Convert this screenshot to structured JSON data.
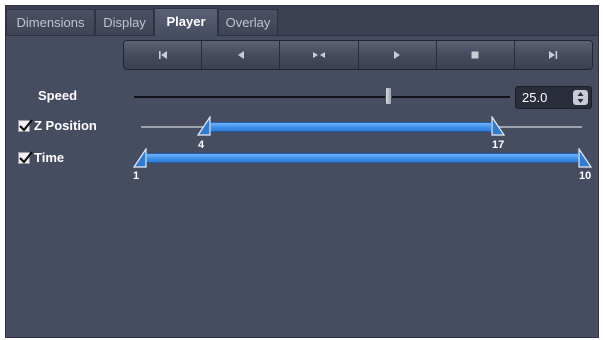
{
  "tabs": [
    {
      "label": "Dimensions",
      "active": false
    },
    {
      "label": "Display",
      "active": false
    },
    {
      "label": "Player",
      "active": true
    },
    {
      "label": "Overlay",
      "active": false
    }
  ],
  "player_controls": [
    {
      "name": "first-frame",
      "icon": "skip-to-start-icon"
    },
    {
      "name": "play-backward",
      "icon": "play-backward-icon"
    },
    {
      "name": "bounce",
      "icon": "bounce-icon"
    },
    {
      "name": "play-forward",
      "icon": "play-icon"
    },
    {
      "name": "stop",
      "icon": "stop-icon"
    },
    {
      "name": "last-frame",
      "icon": "skip-to-end-icon"
    }
  ],
  "speed": {
    "label": "Speed",
    "value": "25.0",
    "slider_fraction": 0.67
  },
  "z_position": {
    "label": "Z Position",
    "checked": true,
    "min_value": "4",
    "max_value": "17"
  },
  "time": {
    "label": "Time",
    "checked": true,
    "min_value": "1",
    "max_value": "10"
  },
  "colors": {
    "panel_bg": "#474d61",
    "range_fill": "#3a8ee8",
    "text": "#ffffff"
  }
}
